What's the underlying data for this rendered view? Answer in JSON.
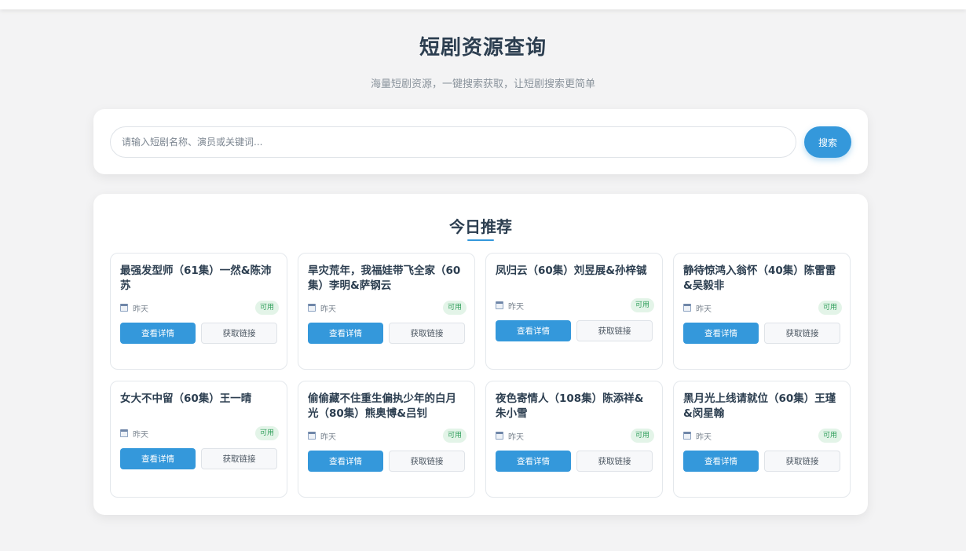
{
  "header": {
    "title": "短剧资源查询",
    "subtitle": "海量短剧资源，一键搜索获取，让短剧搜索更简单"
  },
  "search": {
    "placeholder": "请输入短剧名称、演员或关键词...",
    "button_label": "搜索"
  },
  "recommendations": {
    "title": "今日推荐",
    "items": [
      {
        "title": "最强发型师（61集）一然&陈沛苏",
        "date": "昨天",
        "status": "可用",
        "detail_label": "查看详情",
        "link_label": "获取链接"
      },
      {
        "title": "旱灾荒年，我福娃带飞全家（60集）李明&萨钢云",
        "date": "昨天",
        "status": "可用",
        "detail_label": "查看详情",
        "link_label": "获取链接"
      },
      {
        "title": "凤归云（60集）刘昱展&孙梓铖",
        "date": "昨天",
        "status": "可用",
        "detail_label": "查看详情",
        "link_label": "获取链接"
      },
      {
        "title": "静待惊鸿入翁怀（40集）陈雷雷&吴毅非",
        "date": "昨天",
        "status": "可用",
        "detail_label": "查看详情",
        "link_label": "获取链接"
      },
      {
        "title": "女大不中留（60集）王一晴",
        "date": "昨天",
        "status": "可用",
        "detail_label": "查看详情",
        "link_label": "获取链接"
      },
      {
        "title": "偷偷藏不住重生偏执少年的白月光（80集）熊奥博&吕钊",
        "date": "昨天",
        "status": "可用",
        "detail_label": "查看详情",
        "link_label": "获取链接"
      },
      {
        "title": "夜色寄情人（108集）陈添祥&朱小雪",
        "date": "昨天",
        "status": "可用",
        "detail_label": "查看详情",
        "link_label": "获取链接"
      },
      {
        "title": "黑月光上线请就位（60集）王瑾&闵星翰",
        "date": "昨天",
        "status": "可用",
        "detail_label": "查看详情",
        "link_label": "获取链接"
      }
    ]
  },
  "colors": {
    "accent": "#3498db",
    "badge_bg": "#e3f4e8",
    "badge_text": "#2f9e5a",
    "page_bg": "#f3f3f4"
  },
  "icons": {
    "date": "calendar-icon"
  }
}
